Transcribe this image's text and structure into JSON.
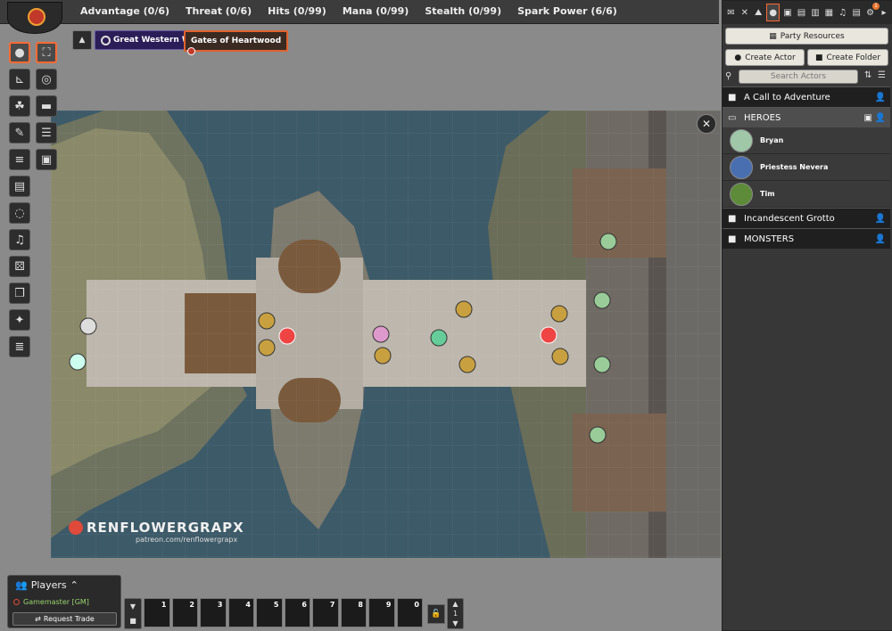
{
  "tracker": [
    {
      "label": "Advantage (0/6)"
    },
    {
      "label": "Threat (0/6)"
    },
    {
      "label": "Hits (0/99)"
    },
    {
      "label": "Mana (0/99)"
    },
    {
      "label": "Stealth (0/99)"
    },
    {
      "label": "Spark Power (6/6)"
    }
  ],
  "scenes": {
    "toggle_icon": "caret-up-icon",
    "items": [
      {
        "label": "Great Western Wold",
        "color": "#2b1d57"
      },
      {
        "label": "Gates of Heartwood",
        "color": "#3a2a22",
        "active": true
      }
    ]
  },
  "controls": [
    {
      "icon": "token-controls-icon",
      "active": true
    },
    {
      "icon": "target-icon",
      "active": false
    },
    {
      "icon": "measure-icon",
      "active": false
    },
    {
      "icon": "tiles-icon",
      "active": false
    },
    {
      "icon": "drawing-icon",
      "active": false
    },
    {
      "icon": "walls-icon",
      "active": false
    },
    {
      "icon": "lighting-icon",
      "active": false
    },
    {
      "icon": "sounds-icon",
      "active": false
    },
    {
      "icon": "journal-notes-icon",
      "active": false
    },
    {
      "icon": "regions-icon",
      "active": false
    },
    {
      "icon": "dice-icon",
      "active": false
    },
    {
      "icon": "bookmark-icon",
      "active": false
    },
    {
      "icon": "magic-icon",
      "active": false
    },
    {
      "icon": "list-icon",
      "active": false
    }
  ],
  "map": {
    "watermark": "RENFLOWERGRAPX",
    "watermark_sub": "patreon.com/renflowergrapx"
  },
  "sidebar": {
    "tabs": [
      "chat-icon",
      "combat-icon",
      "scenes-icon",
      "actors-icon",
      "items-icon",
      "journal-icon",
      "tables-icon",
      "cards-icon",
      "playlists-icon",
      "compendium-icon",
      "settings-icon"
    ],
    "notification_count": "1",
    "party_resources": "Party Resources",
    "create_actor": "Create Actor",
    "create_folder": "Create Folder",
    "search_placeholder": "Search Actors",
    "folders": [
      {
        "name": "A Call to Adventure",
        "open": false
      },
      {
        "name": "HEROES",
        "open": true,
        "actors": [
          {
            "name": "Bryan",
            "color": "#9fc7a8"
          },
          {
            "name": "Priestess Nevera",
            "color": "#4a6fb0"
          },
          {
            "name": "Tim",
            "color": "#5e8b3a"
          }
        ]
      },
      {
        "name": "Incandescent Grotto",
        "open": false
      },
      {
        "name": "MONSTERS",
        "open": false
      }
    ]
  },
  "players": {
    "title": "Players",
    "gm": "Gamemaster [GM]",
    "request_trade": "Request Trade"
  },
  "hotbar": {
    "slots": [
      "1",
      "2",
      "3",
      "4",
      "5",
      "6",
      "7",
      "8",
      "9",
      "0"
    ],
    "page": "1"
  }
}
